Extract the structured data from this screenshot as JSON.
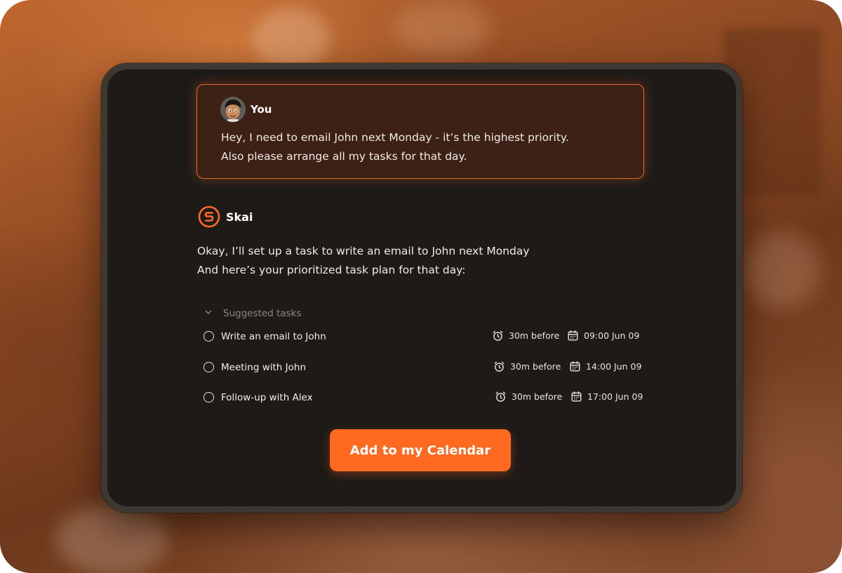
{
  "colors": {
    "accent": "#ff6a20",
    "user_bubble_bg": "#3c2114",
    "card_bg": "#1d1a18"
  },
  "user_message": {
    "sender": "You",
    "avatar_icon": "avatar-cartoon-face",
    "lines": [
      "Hey, I need to email John next Monday - it’s the highest priority.",
      "Also please arrange all my tasks for that day."
    ]
  },
  "assistant_message": {
    "sender": "Skai",
    "logo_icon": "skai-logo-icon",
    "lines": [
      "Okay, I’ll set up a task to write an email to John next Monday",
      "And here’s your prioritized task plan for that day:"
    ]
  },
  "suggested": {
    "label": "Suggested tasks",
    "toggle_icon": "chevron-down-icon",
    "tasks": [
      {
        "title": "Write an email to John",
        "reminder": "30m before",
        "due": "09:00 Jun 09"
      },
      {
        "title": "Meeting with John",
        "reminder": "30m before",
        "due": "14:00 Jun 09"
      },
      {
        "title": "Follow-up with Alex",
        "reminder": "30m before",
        "due": "17:00 Jun 09"
      }
    ]
  },
  "cta": {
    "label": "Add to my Calendar"
  }
}
